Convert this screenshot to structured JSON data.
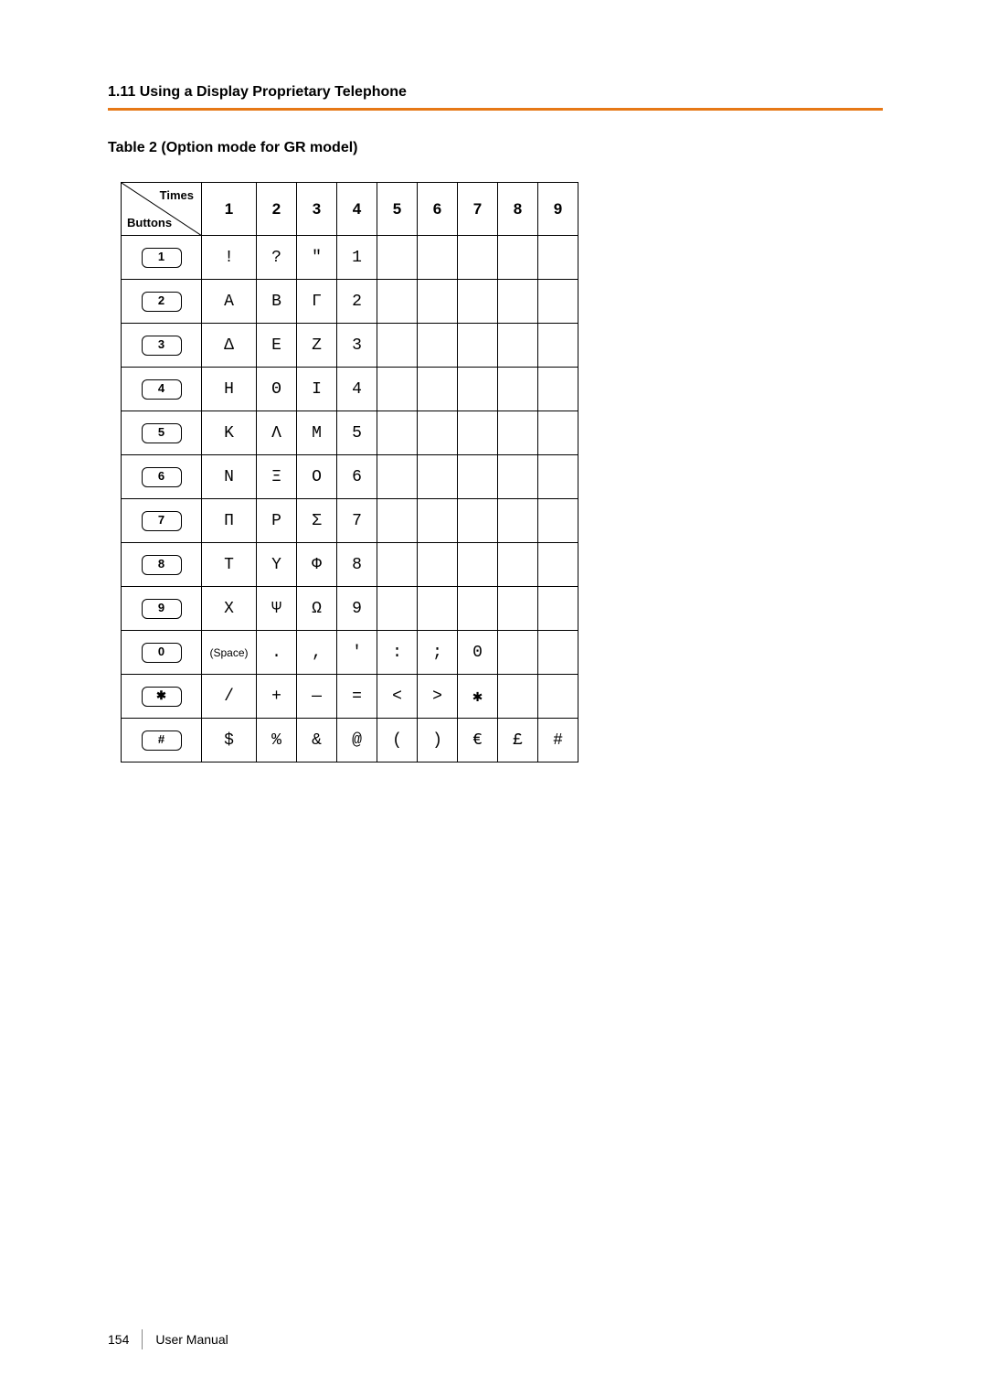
{
  "header": {
    "section_title": "1.11 Using a Display Proprietary Telephone"
  },
  "table": {
    "title": "Table 2 (Option mode for GR model)",
    "corner_top": "Times",
    "corner_bottom": "Buttons",
    "columns": [
      "1",
      "2",
      "3",
      "4",
      "5",
      "6",
      "7",
      "8",
      "9"
    ],
    "rows": [
      {
        "key": "1",
        "cells": [
          "!",
          "?",
          "\"",
          "1",
          "",
          "",
          "",
          "",
          ""
        ]
      },
      {
        "key": "2",
        "cells": [
          "Α",
          "Β",
          "Γ",
          "2",
          "",
          "",
          "",
          "",
          ""
        ]
      },
      {
        "key": "3",
        "cells": [
          "Δ",
          "Ε",
          "Ζ",
          "3",
          "",
          "",
          "",
          "",
          ""
        ]
      },
      {
        "key": "4",
        "cells": [
          "Η",
          "Θ",
          "Ι",
          "4",
          "",
          "",
          "",
          "",
          ""
        ]
      },
      {
        "key": "5",
        "cells": [
          "Κ",
          "Λ",
          "Μ",
          "5",
          "",
          "",
          "",
          "",
          ""
        ]
      },
      {
        "key": "6",
        "cells": [
          "Ν",
          "Ξ",
          "Ο",
          "6",
          "",
          "",
          "",
          "",
          ""
        ]
      },
      {
        "key": "7",
        "cells": [
          "Π",
          "Ρ",
          "Σ",
          "7",
          "",
          "",
          "",
          "",
          ""
        ]
      },
      {
        "key": "8",
        "cells": [
          "Τ",
          "Υ",
          "Φ",
          "8",
          "",
          "",
          "",
          "",
          ""
        ]
      },
      {
        "key": "9",
        "cells": [
          "Χ",
          "Ψ",
          "Ω",
          "9",
          "",
          "",
          "",
          "",
          ""
        ]
      },
      {
        "key": "0",
        "cells": [
          "(Space)",
          ".",
          ",",
          "'",
          ":",
          ";",
          "0",
          "",
          ""
        ]
      },
      {
        "key": "✱",
        "cells": [
          "/",
          "+",
          "—",
          "=",
          "<",
          ">",
          "✱",
          "",
          ""
        ]
      },
      {
        "key": "#",
        "cells": [
          "$",
          "%",
          "&",
          "@",
          "(",
          ")",
          "€",
          "£",
          "#"
        ]
      }
    ]
  },
  "footer": {
    "page_number": "154",
    "doc_label": "User Manual"
  }
}
